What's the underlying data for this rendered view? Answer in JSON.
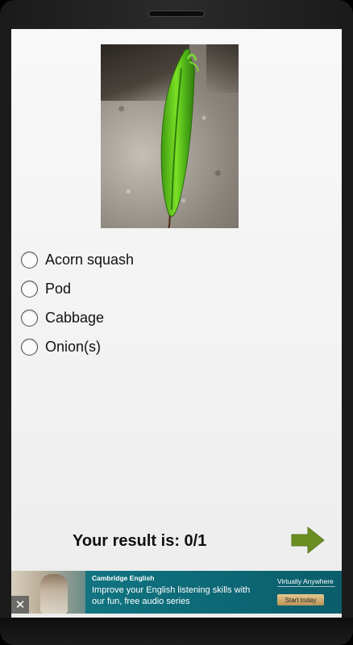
{
  "quiz": {
    "image_icon": "pea-pod-photo",
    "options": [
      {
        "label": "Acorn squash"
      },
      {
        "label": "Pod"
      },
      {
        "label": "Cabbage"
      },
      {
        "label": "Onion(s)"
      }
    ],
    "result_text": "Your result is: 0/1",
    "next_icon": "arrow-right-icon",
    "accent_color": "#6b8e23"
  },
  "ad": {
    "brand": "Cambridge English",
    "text": "Improve your English listening skills with our fun, free audio series",
    "tagline": "Virtually Anywhere",
    "cta": "Start today",
    "close_icon": "close-icon"
  }
}
